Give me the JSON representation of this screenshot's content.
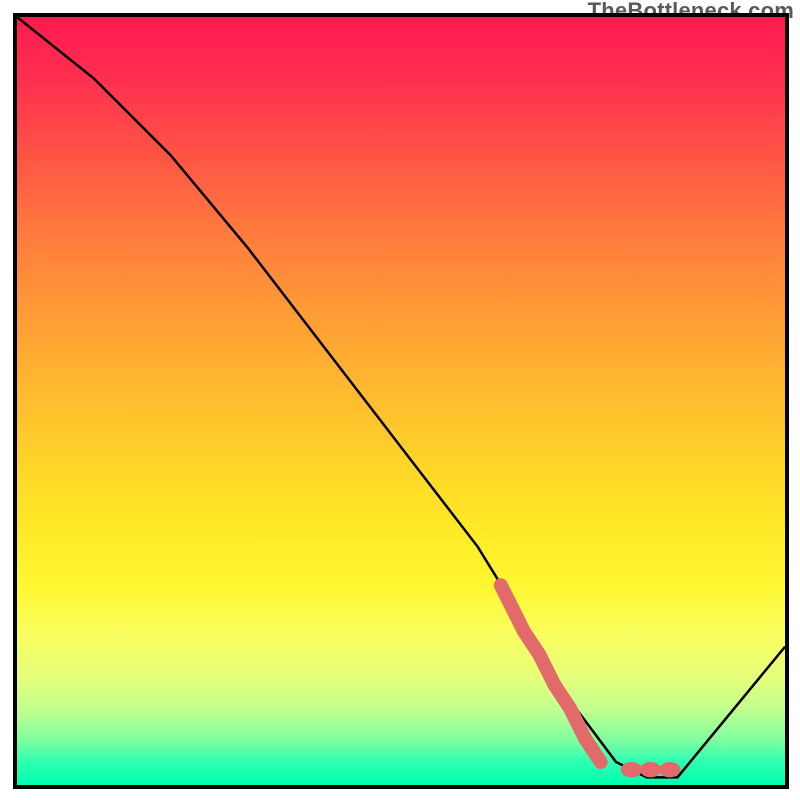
{
  "watermark": "TheBottleneck.com",
  "chart_data": {
    "type": "line",
    "title": "",
    "xlabel": "",
    "ylabel": "",
    "xlim": [
      0,
      100
    ],
    "ylim": [
      0,
      100
    ],
    "grid": false,
    "series": [
      {
        "name": "curve",
        "stroke": "#000000",
        "x": [
          0,
          10,
          20,
          30,
          40,
          50,
          60,
          68,
          72,
          78,
          82,
          86,
          100
        ],
        "y": [
          100,
          92,
          82,
          70,
          57,
          44,
          31,
          18,
          11,
          3,
          1,
          1,
          18
        ]
      },
      {
        "name": "highlight-segment",
        "stroke": "#e26a6a",
        "style": "thick",
        "x": [
          63,
          64,
          66,
          68,
          70,
          72,
          74,
          76
        ],
        "y": [
          26,
          24,
          20,
          17,
          13,
          10,
          6,
          3
        ]
      },
      {
        "name": "highlight-dots",
        "stroke": "#e26a6a",
        "style": "dots",
        "x": [
          80,
          82.5,
          85
        ],
        "y": [
          2,
          2,
          2
        ]
      }
    ],
    "gradient_stops": [
      {
        "pos": 0,
        "color": "#ff1a4f"
      },
      {
        "pos": 18,
        "color": "#ff5445"
      },
      {
        "pos": 38,
        "color": "#ff9a36"
      },
      {
        "pos": 58,
        "color": "#ffd429"
      },
      {
        "pos": 74,
        "color": "#fff731"
      },
      {
        "pos": 90,
        "color": "#c3ff8e"
      },
      {
        "pos": 100,
        "color": "#00ffb0"
      }
    ]
  }
}
